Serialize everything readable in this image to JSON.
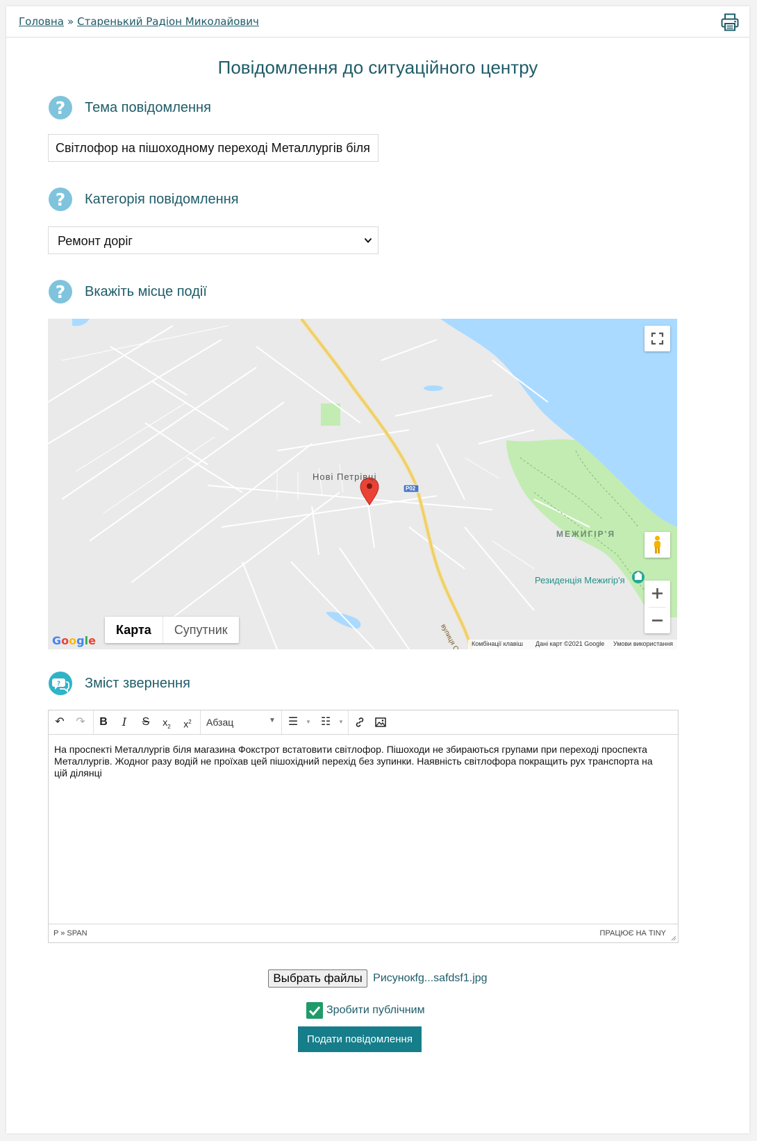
{
  "breadcrumb": {
    "home": "Головна",
    "separator": "»",
    "user": "Старенький Радіон Миколайович"
  },
  "page_title": "Повідомлення до ситуаційного центру",
  "subject": {
    "label": "Тема повідомлення",
    "value": "Світлофор на пішоходному переході Металлургів біля Ф"
  },
  "category": {
    "label": "Категорія повідомлення",
    "selected": "Ремонт доріг"
  },
  "location": {
    "label": "Вкажіть місце події",
    "map": {
      "type_map": "Карта",
      "type_satellite": "Супутник",
      "place_1": "Нові Петрівці",
      "place_2": "МЕЖИГІР'Я",
      "poi": "Резиденція Межигір'я",
      "road_badge": "Р02",
      "street": "вулиця Св",
      "google": "Google",
      "shortcuts": "Комбінації клавіш",
      "map_data": "Дані карт ©2021 Google",
      "terms": "Умови використання",
      "colors": {
        "water": "#aadaff",
        "park": "#c3ecb2",
        "land": "#eaeaea",
        "highway": "#f5d97a",
        "marker": "#ea4335"
      }
    }
  },
  "content": {
    "label": "Зміст звернення",
    "toolbar": {
      "paragraph": "Абзац"
    },
    "body": "На проспекті Металлургів біля магазина Фокстрот встатовити світлофор. Пішоходи не збираються групами при переході проспекта Металлургів. Жодног разу водій не проїхав цей пішохідний перехід без зупинки. Наявність світлофора покращить рух транспорта на цій ділянці",
    "status_path": "P » SPAN",
    "powered": "ПРАЦЮЄ НА TINY"
  },
  "file": {
    "button": "Выбрать файлы",
    "name": "Рисунокfg...safdsf1.jpg"
  },
  "public": {
    "label": "Зробити публічним",
    "checked": true
  },
  "submit": "Подати повідомлення",
  "colors": {
    "accent": "#167d8a",
    "heading": "#1e5c68",
    "help_icon": "#7fc4dc",
    "checkbox": "#1f9b69"
  }
}
